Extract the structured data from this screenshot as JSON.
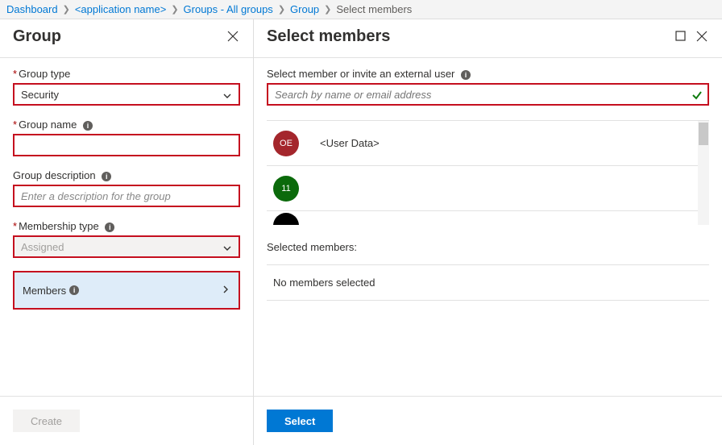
{
  "breadcrumb": {
    "items": [
      {
        "label": "Dashboard"
      },
      {
        "label": "<application name>"
      },
      {
        "label": "Groups - All groups"
      },
      {
        "label": "Group"
      },
      {
        "label": "Select members"
      }
    ]
  },
  "left": {
    "title": "Group",
    "fields": {
      "group_type": {
        "label": "Group type",
        "value": "Security",
        "required": true
      },
      "group_name": {
        "label": "Group name",
        "value": "",
        "required": true
      },
      "group_desc": {
        "label": "Group description",
        "placeholder": "Enter a description for the group",
        "required": false
      },
      "membership_type": {
        "label": "Membership type",
        "value": "Assigned",
        "required": true,
        "disabled": true
      },
      "members": {
        "label": "Members"
      }
    },
    "footer": {
      "create": "Create"
    }
  },
  "right": {
    "title": "Select members",
    "search": {
      "label": "Select member or invite an external user",
      "placeholder": "Search by name or email address"
    },
    "list": [
      {
        "initials": "OE",
        "name": "<User Data>",
        "color": "av-red"
      },
      {
        "initials": "11",
        "name": "",
        "color": "av-green"
      }
    ],
    "selected": {
      "label": "Selected members:",
      "empty": "No members selected"
    },
    "footer": {
      "select": "Select"
    }
  }
}
